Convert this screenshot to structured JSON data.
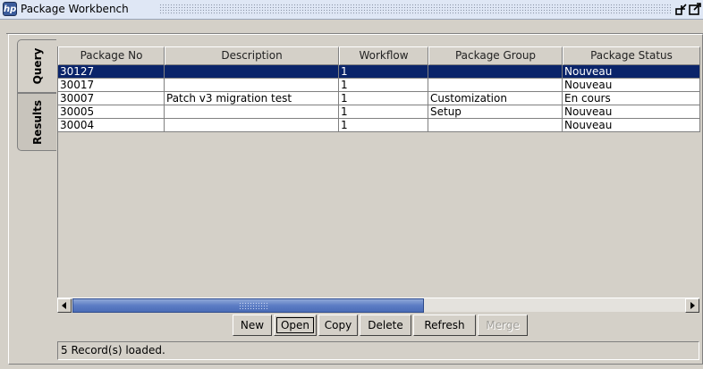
{
  "window": {
    "title": "Package Workbench",
    "app_icon": "hp-logo-icon",
    "controls": [
      "restore-icon",
      "maximize-icon"
    ]
  },
  "tabs": [
    {
      "label": "Query"
    },
    {
      "label": "Results"
    }
  ],
  "table": {
    "columns": [
      "Package No",
      "Description",
      "Workflow",
      "Package Group",
      "Package Status"
    ],
    "rows": [
      {
        "package_no": "30127",
        "description": "",
        "workflow": "1",
        "group": "",
        "status": "Nouveau"
      },
      {
        "package_no": "30017",
        "description": "",
        "workflow": "1",
        "group": "",
        "status": "Nouveau"
      },
      {
        "package_no": "30007",
        "description": "Patch v3 migration test",
        "workflow": "1",
        "group": "Customization",
        "status": "En cours"
      },
      {
        "package_no": "30005",
        "description": "",
        "workflow": "1",
        "group": "Setup",
        "status": "Nouveau"
      },
      {
        "package_no": "30004",
        "description": "",
        "workflow": "1",
        "group": "",
        "status": "Nouveau"
      }
    ],
    "selected_row": 0
  },
  "buttons": {
    "new": "New",
    "open": "Open",
    "copy": "Copy",
    "delete": "Delete",
    "refresh": "Refresh",
    "merge": "Merge"
  },
  "status": "5 Record(s) loaded.",
  "colors": {
    "selection": "#0a246a",
    "scroll_thumb": "#5b7cc4",
    "background": "#d4d0c8"
  }
}
